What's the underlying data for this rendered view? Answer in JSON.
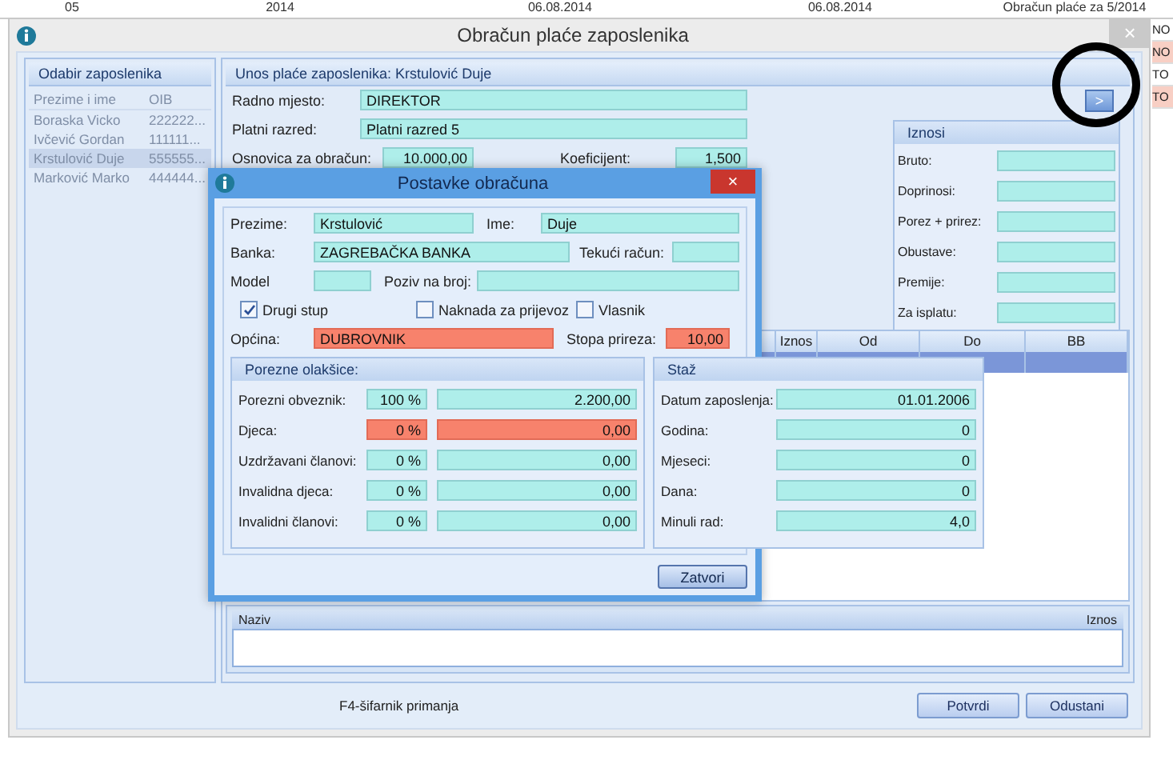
{
  "background": {
    "top_row": [
      "05",
      "2014",
      "06.08.2014",
      "06.08.2014",
      "Obračun plaće za 5/2014"
    ],
    "rows": [
      {
        "status": "NO",
        "color": "#ffffff"
      },
      {
        "status": "NO",
        "color": "#f8cfc4"
      },
      {
        "status": "TO",
        "color": "#ffffff"
      },
      {
        "status": "TO",
        "color": "#f8cfc4"
      }
    ]
  },
  "window": {
    "title": "Obračun plaće zaposlenika",
    "close": "×"
  },
  "employee_panel": {
    "title": "Odabir zaposlenika",
    "disabled": true,
    "columns": [
      "Prezime i ime",
      "OIB"
    ],
    "rows": [
      {
        "name": "Boraska Vicko",
        "oib": "222222...",
        "selected": false
      },
      {
        "name": "Ivčević Gordan",
        "oib": "111111...",
        "selected": false
      },
      {
        "name": "Krstulović Duje",
        "oib": "555555...",
        "selected": true
      },
      {
        "name": "Marković Marko",
        "oib": "444444...",
        "selected": false
      }
    ]
  },
  "entry_panel": {
    "title": "Unos plaće zaposlenika: Krstulović Duje",
    "fields": [
      {
        "label": "Radno mjesto:",
        "value": "DIREKTOR"
      },
      {
        "label": "Platni razred:",
        "value": "Platni razred 5"
      }
    ],
    "base": {
      "label": "Osnovica za obračun:",
      "value": "10.000,00"
    },
    "coefficient": {
      "label": "Koeficijent:",
      "value": "1,500"
    },
    "next_button": ">",
    "totals": {
      "title": "Iznosi",
      "fields": [
        {
          "label": "Bruto:"
        },
        {
          "label": "Doprinosi:"
        },
        {
          "label": "Porez + prirez:"
        },
        {
          "label": "Obustave:"
        },
        {
          "label": "Premije:"
        },
        {
          "label": "Za isplatu:"
        }
      ]
    },
    "grid": {
      "columns": [
        "Iznos",
        "Od",
        "Do",
        "BB"
      ],
      "rows": [
        {
          "selected": true
        }
      ]
    },
    "items_list": {
      "columns": [
        "Naziv",
        "Iznos"
      ]
    }
  },
  "footer": {
    "hint": "F4-šifarnik primanja",
    "buttons": [
      "Potvrdi",
      "Odustani"
    ]
  },
  "dialog": {
    "title": "Postavke obračuna",
    "close": "×",
    "rows": [
      [
        {
          "label": "Prezime:",
          "value": "Krstulović"
        },
        {
          "label": "Ime:",
          "value": "Duje"
        }
      ],
      [
        {
          "label": "Banka:",
          "value": "ZAGREBAČKA BANKA"
        },
        {
          "label": "Tekući račun:"
        }
      ],
      [
        {
          "label": "Model"
        },
        {
          "label": "Poziv na broj:"
        }
      ]
    ],
    "checkboxes": [
      {
        "label": "Drugi stup",
        "checked": true
      },
      {
        "label": "Naknada za prijevoz",
        "checked": false
      },
      {
        "label": "Vlasnik",
        "checked": false
      }
    ],
    "municipality": {
      "label": "Općina:",
      "value": "DUBROVNIK",
      "warning": true
    },
    "surtax": {
      "label": "Stopa prireza:",
      "value": "10,00",
      "warning": true
    },
    "tax_relief": {
      "title": "Porezne olakšice:",
      "rows": [
        {
          "label": "Porezni obveznik:",
          "percent": "100 %",
          "amount": "2.200,00",
          "warning": false
        },
        {
          "label": "Djeca:",
          "percent": "0 %",
          "amount": "0,00",
          "warning": true
        },
        {
          "label": "Uzdržavani članovi:",
          "percent": "0 %",
          "amount": "0,00",
          "warning": false
        },
        {
          "label": "Invalidna djeca:",
          "percent": "0 %",
          "amount": "0,00",
          "warning": false
        },
        {
          "label": "Invalidni članovi:",
          "percent": "0 %",
          "amount": "0,00",
          "warning": false
        }
      ]
    },
    "service": {
      "title": "Staž",
      "rows": [
        {
          "label": "Datum zaposlenja:",
          "value": "01.01.2006"
        },
        {
          "label": "Godina:",
          "value": "0"
        },
        {
          "label": "Mjeseci:",
          "value": "0"
        },
        {
          "label": "Dana:",
          "value": "0"
        },
        {
          "label": "Minuli rad:",
          "value": "4,0"
        }
      ]
    },
    "close_button": "Zatvori"
  }
}
